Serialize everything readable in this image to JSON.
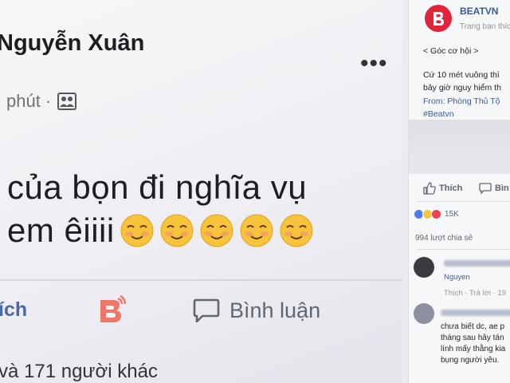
{
  "post": {
    "author": "Nguyễn Xuân",
    "more_label": "•••",
    "time": "phút",
    "separator": "·",
    "status_line1": "của bọn đi nghĩa vụ",
    "status_line2": "em êiiii",
    "emoji_count": 5,
    "actions": {
      "like": "ích",
      "comment": "Bình luận"
    },
    "likes_summary": "và 171 người khác"
  },
  "sidebar": {
    "page_name": "BEATVN",
    "page_sub": "Trang bạn thíc",
    "tag": "< Góc cơ hội >",
    "body_line1": "Cứ 10 mét vuông thì",
    "body_line2": "bây giờ nguy hiểm th",
    "from_label": "From:",
    "from_value": "Phòng Thủ Tộ",
    "hashtag": "#Beatvn",
    "like_label": "Thích",
    "comment_label": "Bìn",
    "reaction_count": "15K",
    "shares": "994 lượt chia sẻ",
    "comment1_sub": "Nguyen",
    "comment1_actions": "Thích · Trả lời · 19",
    "comment2_lines": [
      "chưa biết dc, ae p",
      "tháng sau hãy tán",
      "lính mấy thằng kia",
      "bụng người yêu."
    ]
  },
  "colors": {
    "brand": "#e0243a",
    "link": "#3b5998",
    "like_blue": "#4b67a8"
  }
}
